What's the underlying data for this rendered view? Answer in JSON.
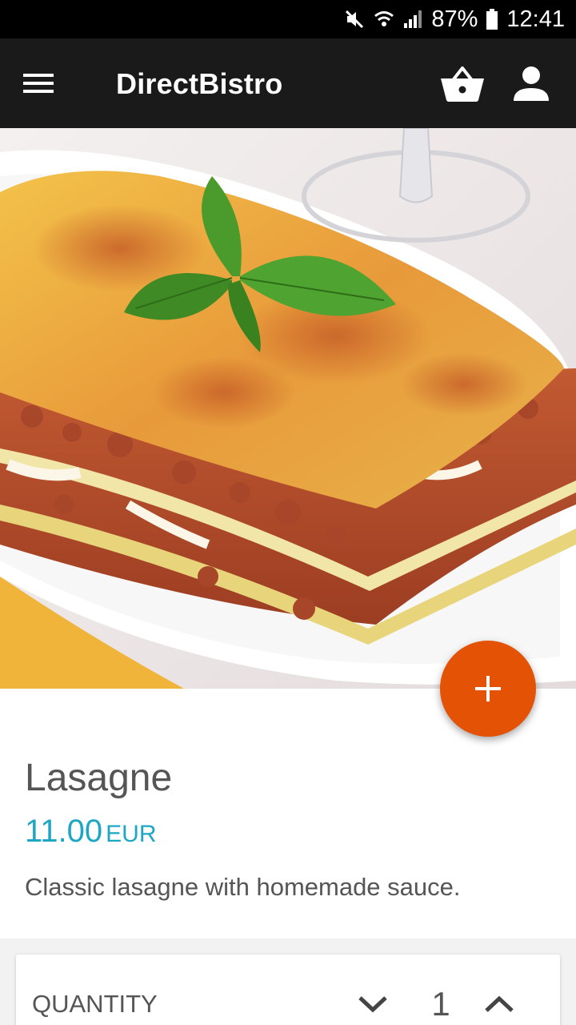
{
  "status_bar": {
    "battery": "87%",
    "time": "12:41",
    "icons": [
      "mute-icon",
      "wifi-icon",
      "signal-icon",
      "battery-icon"
    ]
  },
  "app_bar": {
    "title": "DirectBistro",
    "icons": [
      "menu-icon",
      "basket-icon",
      "account-icon"
    ]
  },
  "product": {
    "name": "Lasagne",
    "price": "11.00",
    "currency": "EUR",
    "description": "Classic lasagne with homemade sauce.",
    "image": "lasagne-photo"
  },
  "fab": {
    "icon": "plus-icon",
    "color": "#e35205"
  },
  "quantity": {
    "label": "QUANTITY",
    "value": "1",
    "icons": [
      "chevron-down-icon",
      "chevron-up-icon"
    ]
  },
  "colors": {
    "app_bar": "#1a1a1a",
    "accent": "#e35205",
    "price": "#1ea7c4",
    "text": "#555555"
  }
}
